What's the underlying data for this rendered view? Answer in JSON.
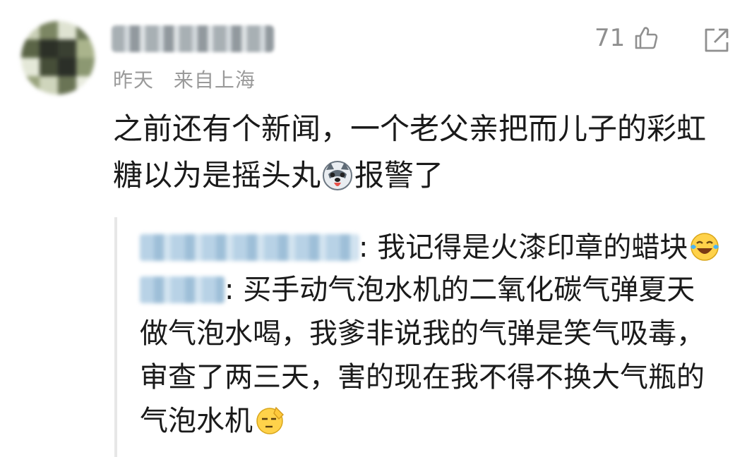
{
  "comment": {
    "time": "昨天",
    "location": "来自上海",
    "like_count": "71",
    "text_part1": "之前还有个新闻，一个老父亲把而儿子的彩虹糖以为是摇头丸",
    "text_part2": "报警了"
  },
  "replies": [
    {
      "text": ": 我记得是火漆印章的蜡块"
    },
    {
      "text": ": 买手动气泡水机的二氧化碳气弹夏天做气泡水喝，我爹非说我的气弹是笑气吸毒，审查了两三天，害的现在我不得不换大气瓶的气泡水机"
    }
  ],
  "icons": {
    "like": "thumbs-up-icon",
    "share": "share-icon",
    "emoji_husky": "husky-emoji-icon",
    "emoji_laugh_cry": "laughing-crying-emoji-icon",
    "emoji_salute": "salute-emoji-icon"
  }
}
